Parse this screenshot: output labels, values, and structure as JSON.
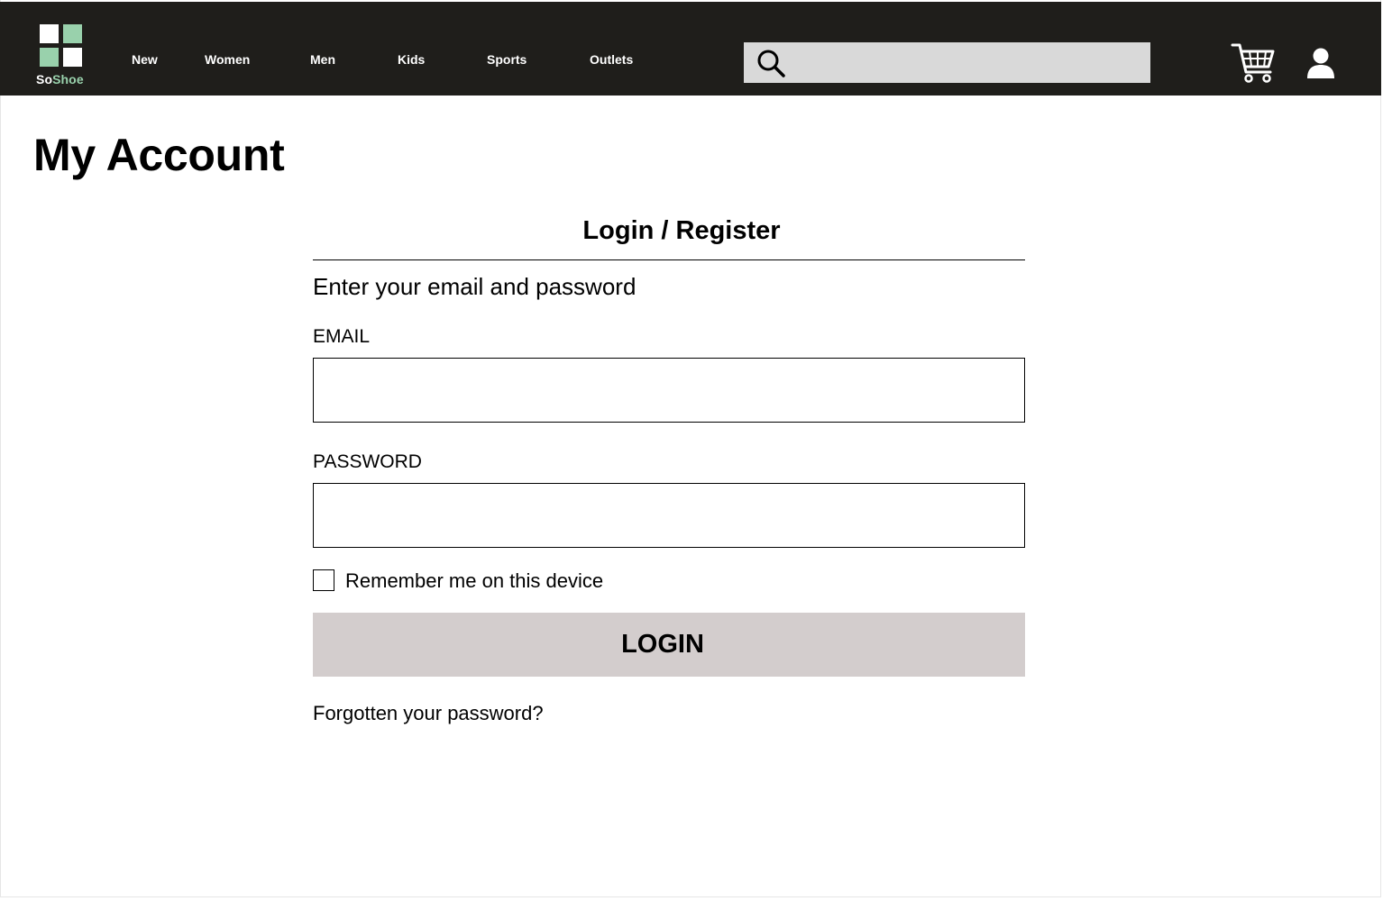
{
  "header": {
    "brand": {
      "part1": "So",
      "part2": "Shoe"
    },
    "nav": [
      "New",
      "Women",
      "Men",
      "Kids",
      "Sports",
      "Outlets"
    ],
    "search": {
      "value": "",
      "placeholder": ""
    },
    "icons": [
      "search-icon",
      "cart-icon",
      "user-icon"
    ],
    "colors": {
      "bar": "#1f1e1b",
      "logo_accent": "#99d1ac",
      "search_bg": "#d9d9d9"
    }
  },
  "page": {
    "title": "My Account"
  },
  "login": {
    "title": "Login / Register",
    "intro": "Enter your email and password",
    "email_label": "EMAIL",
    "email_value": "",
    "password_label": "PASSWORD",
    "password_value": "",
    "remember_label": "Remember me on this device",
    "remember_checked": false,
    "login_button": "LOGIN",
    "forgot_link": "Forgotten your password?",
    "colors": {
      "button_bg": "#d3cdcd"
    }
  }
}
